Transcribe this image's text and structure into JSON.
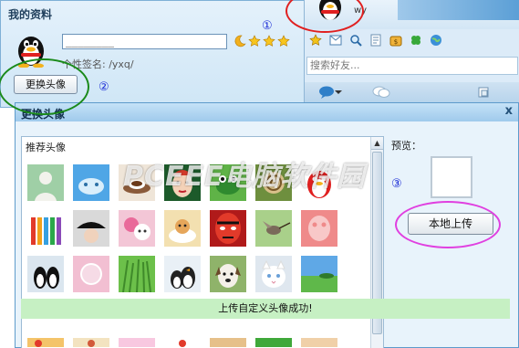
{
  "profile_window": {
    "title": "我的资料",
    "nickname_value": "________",
    "signature_label": "个性签名: /yxq/",
    "change_avatar_button": "更换头像",
    "level_icons": [
      "moon-icon",
      "star-icon",
      "star-icon",
      "star-icon"
    ]
  },
  "qq_panel": {
    "user_name": "wy",
    "search_placeholder": "搜索好友...",
    "toolbar_icons": [
      "star-icon",
      "mail-icon",
      "search-icon",
      "document-icon",
      "money-bag-icon",
      "clover-icon",
      "globe-icon"
    ],
    "tabs": [
      "chat-bubble-icon",
      "chat-bubbles-icon",
      "group-icon"
    ]
  },
  "dialog": {
    "title": "更换头像",
    "recommended_label": "推荐头像",
    "preview_label": "预览：",
    "upload_button": "本地上传",
    "success_message": "上传自定义头像成功!",
    "close_symbol": "x"
  },
  "annotations": {
    "n1": "①",
    "n2": "②",
    "n3": "③"
  },
  "watermark": "PCEEE电脑软件园",
  "colors": {
    "annotation_red": "#e02020",
    "annotation_green": "#1a8a1a",
    "annotation_magenta": "#e040e0",
    "success_bg": "#c6f0c3"
  },
  "avatar_grid": [
    "sketch-person",
    "sky-face",
    "coffee-cup",
    "opera-mask",
    "frog",
    "snail",
    "qq-penguin-red",
    "colored-pencils",
    "fashion-hat",
    "flower-cat",
    "cat-plate",
    "face-mask",
    "hummingbird",
    "qq-silhouette",
    "penguin-black",
    "pink-frame",
    "grass",
    "penguin-couple",
    "dog",
    "white-cat",
    "hill-landscape",
    "partial-1",
    "partial-2",
    "partial-3",
    "partial-4",
    "partial-5",
    "partial-6",
    "partial-7"
  ]
}
